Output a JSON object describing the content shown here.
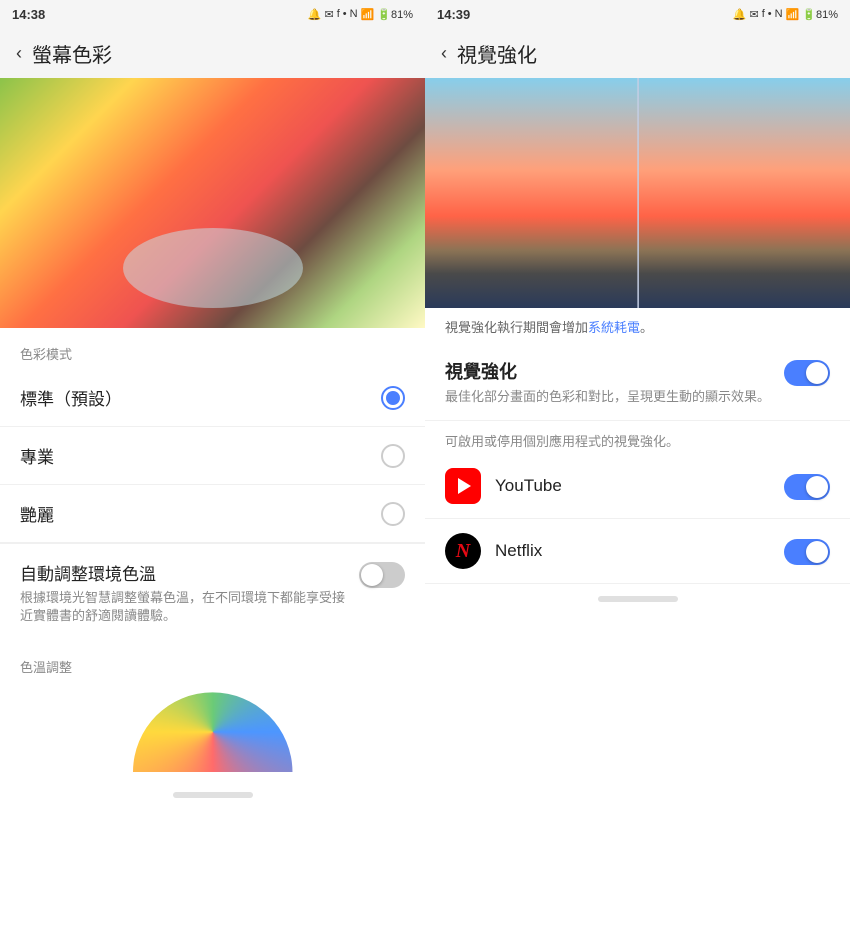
{
  "left_panel": {
    "status_bar": {
      "time": "14:38",
      "icons": "N ⊕ ☁ ☎ .ill 81%"
    },
    "header": {
      "back_label": "‹",
      "title": "螢幕色彩"
    },
    "section_label": "色彩模式",
    "radio_items": [
      {
        "id": "standard",
        "label": "標準（預設）",
        "selected": true
      },
      {
        "id": "professional",
        "label": "專業",
        "selected": false
      },
      {
        "id": "vivid",
        "label": "艷麗",
        "selected": false
      }
    ],
    "auto_adjust": {
      "title": "自動調整環境色溫",
      "desc": "根據環境光智慧調整螢幕色溫，在不同環境下都能享受接近實體書的舒適閱讀體驗。",
      "enabled": false
    },
    "color_temp_section": {
      "label": "色溫調整"
    }
  },
  "right_panel": {
    "status_bar": {
      "time": "14:39",
      "icons": "N ⊕ ☁ ☎ .ill 81%"
    },
    "header": {
      "back_label": "‹",
      "title": "視覺強化"
    },
    "notice": "視覺強化執行期間會增加",
    "notice_link": "系統耗電",
    "notice_end": "。",
    "vivid_section": {
      "title": "視覺強化",
      "desc": "最佳化部分畫面的色彩和對比，呈現更生動的顯示效果。",
      "enabled": true
    },
    "sub_notice": "可啟用或停用個別應用程式的視覺強化。",
    "apps": [
      {
        "id": "youtube",
        "name": "YouTube",
        "enabled": true
      },
      {
        "id": "netflix",
        "name": "Netflix",
        "enabled": true
      }
    ]
  }
}
